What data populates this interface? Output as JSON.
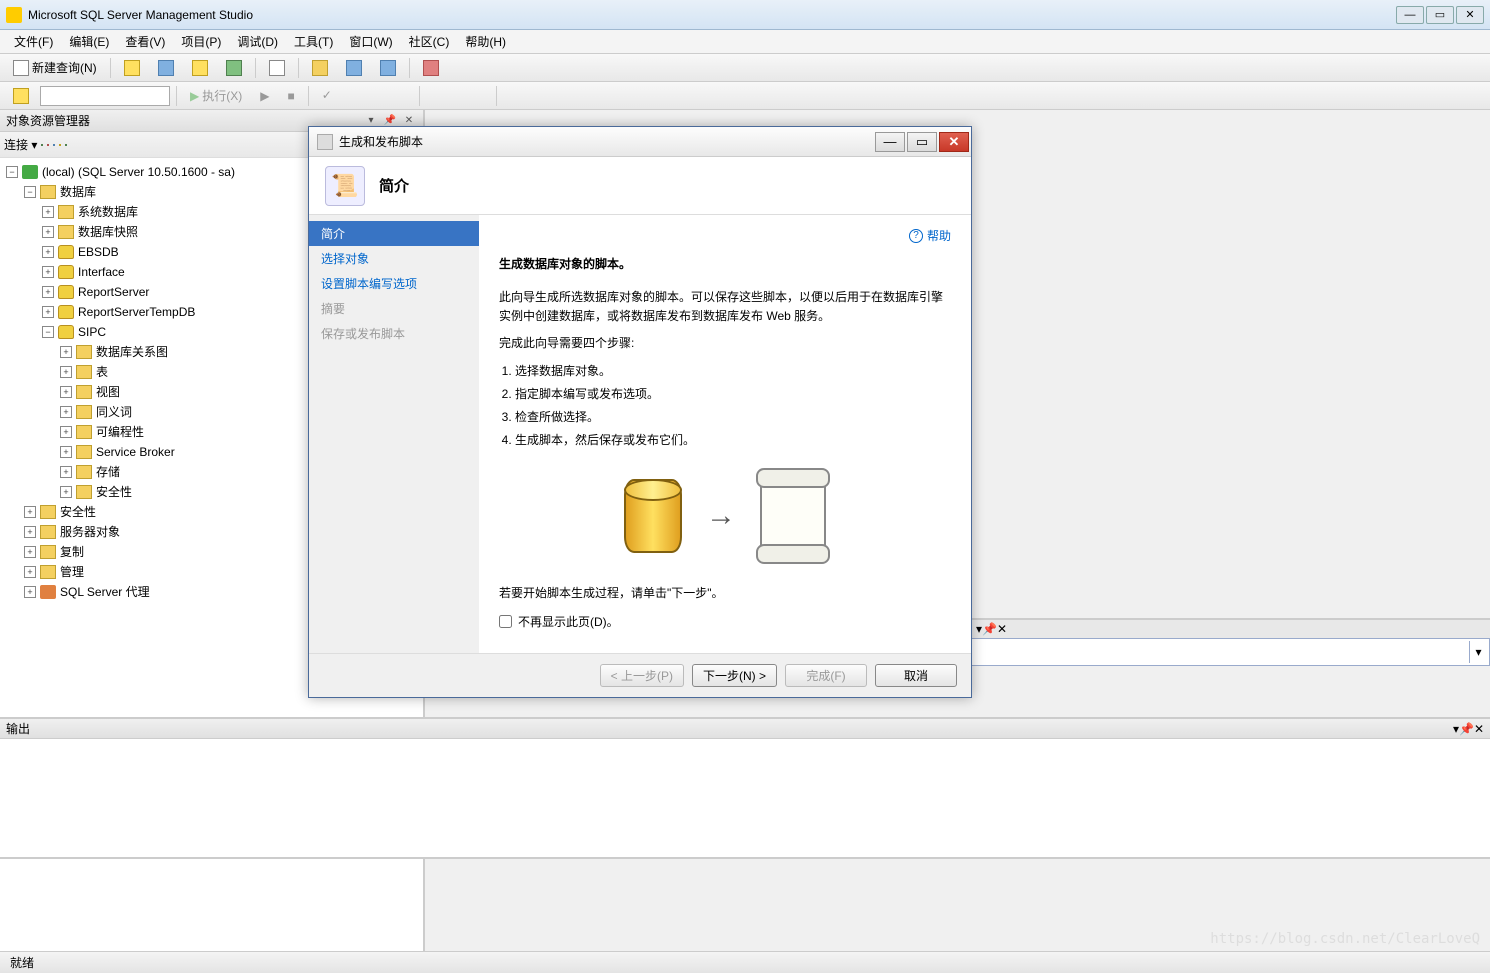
{
  "window": {
    "title": "Microsoft SQL Server Management Studio"
  },
  "menu": {
    "file": "文件(F)",
    "edit": "编辑(E)",
    "view": "查看(V)",
    "project": "项目(P)",
    "debug": "调试(D)",
    "tools": "工具(T)",
    "window": "窗口(W)",
    "community": "社区(C)",
    "help": "帮助(H)"
  },
  "toolbar": {
    "new_query": "新建查询(N)",
    "execute": "执行(X)"
  },
  "object_explorer": {
    "title": "对象资源管理器",
    "connect": "连接 ▾",
    "root": "(local) (SQL Server 10.50.1600 - sa)",
    "databases": "数据库",
    "sys_db": "系统数据库",
    "db_snap": "数据库快照",
    "db1": "EBSDB",
    "db2": "Interface",
    "db3": "ReportServer",
    "db4": "ReportServerTempDB",
    "db5": "SIPC",
    "sipc_diagram": "数据库关系图",
    "sipc_tables": "表",
    "sipc_views": "视图",
    "sipc_syn": "同义词",
    "sipc_prog": "可编程性",
    "sipc_sb": "Service Broker",
    "sipc_storage": "存储",
    "sipc_security": "安全性",
    "security": "安全性",
    "server_obj": "服务器对象",
    "replication": "复制",
    "management": "管理",
    "agent": "SQL Server 代理"
  },
  "output": {
    "title": "输出"
  },
  "status": {
    "ready": "就绪"
  },
  "dialog": {
    "title": "生成和发布脚本",
    "header": "简介",
    "nav": {
      "intro": "简介",
      "choose": "选择对象",
      "options": "设置脚本编写选项",
      "summary": "摘要",
      "save": "保存或发布脚本"
    },
    "help": "帮助",
    "h3": "生成数据库对象的脚本。",
    "desc": "此向导生成所选数据库对象的脚本。可以保存这些脚本，以便以后用于在数据库引擎实例中创建数据库，或将数据库发布到数据库发布 Web 服务。",
    "steps_intro": "完成此向导需要四个步骤:",
    "step1": "选择数据库对象。",
    "step2": "指定脚本编写或发布选项。",
    "step3": "检查所做选择。",
    "step4": "生成脚本，然后保存或发布它们。",
    "start_hint": "若要开始脚本生成过程，请单击\"下一步\"。",
    "dont_show": "不再显示此页(D)。",
    "btn_prev": "< 上一步(P)",
    "btn_next": "下一步(N) >",
    "btn_finish": "完成(F)",
    "btn_cancel": "取消"
  },
  "watermark": "https://blog.csdn.net/ClearLoveQ"
}
